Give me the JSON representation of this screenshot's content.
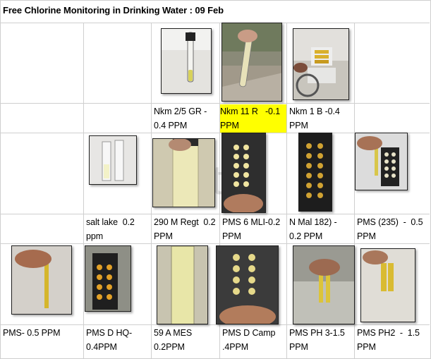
{
  "title": "Free Chlorine Monitoring in Drinking Water : 09 Feb",
  "watermark": "te",
  "colors": {
    "highlight": "#ffff00",
    "grid": "#cfcfcf"
  },
  "rows": [
    {
      "samples": [
        {
          "label": "Nkm 2/5 GR -\n0.4 PPM",
          "photo": "test-tube-white-wall-photo"
        },
        {
          "label": "Nkm 11 R   -0.1\nPPM",
          "highlighted": true,
          "photo": "hand-held-tube-photo"
        },
        {
          "label": "Nkm 1 B -0.4\nPPM",
          "photo": "comparator-kit-photo"
        }
      ]
    },
    {
      "samples": [
        {
          "label": "salt lake  0.2\nppm",
          "photo": "two-vials-photo"
        },
        {
          "label": "290 M Regt  0.2\nPPM",
          "photo": "yellow-tube-closeup-photo"
        },
        {
          "label": "PMS 6 MLI-0.2\nPPM",
          "photo": "comparator-disc-hand-photo"
        },
        {
          "label": "N Mal 182) -\n0.2 PPM",
          "photo": "black-comparator-photo"
        },
        {
          "label": "PMS (235)  -  0.5\nPPM",
          "photo": "hand-comparator-photo"
        }
      ]
    },
    {
      "samples": [
        {
          "label": "PMS- 0.5 PPM",
          "photo": "hand-tube-wall-photo"
        },
        {
          "label": "PMS D HQ-\n0.4PPM",
          "photo": "comparator-outdoor-photo"
        },
        {
          "label": "59 A MES\n0.2PPM",
          "photo": "tube-closeup-photo"
        },
        {
          "label": "PMS D Camp\n.4PPM",
          "photo": "comparator-in-hand-photo"
        },
        {
          "label": "PMS PH 3-1.5\nPPM",
          "photo": "two-tubes-hand-photo"
        },
        {
          "label": "PMS PH2  -  1.5\nPPM",
          "photo": "tubes-in-comparator-photo"
        }
      ]
    }
  ]
}
